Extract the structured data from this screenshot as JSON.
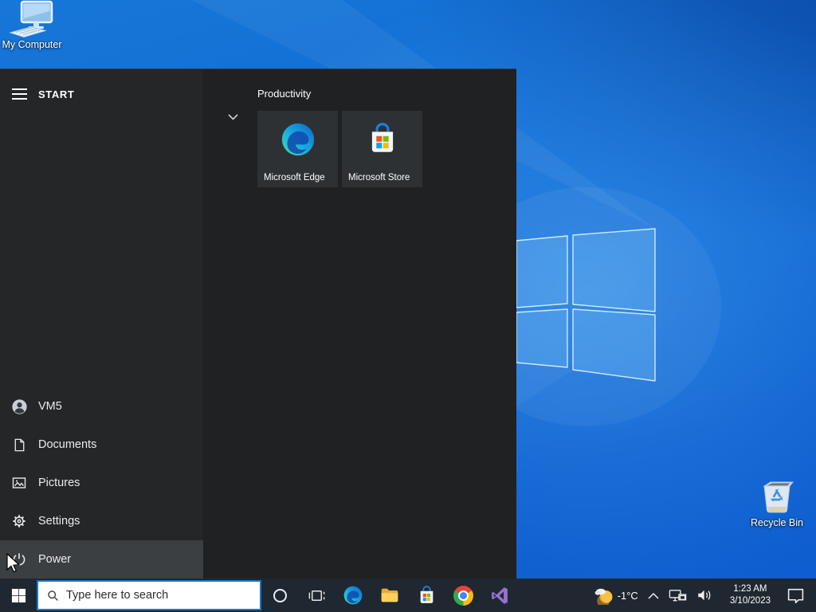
{
  "desktop": {
    "my_computer_label": "My Computer",
    "recycle_bin_label": "Recycle Bin"
  },
  "start_menu": {
    "header_label": "START",
    "group": {
      "title": "Productivity"
    },
    "tiles": [
      {
        "label": "Microsoft Edge"
      },
      {
        "label": "Microsoft Store"
      }
    ],
    "nav": [
      {
        "label": "VM5"
      },
      {
        "label": "Documents"
      },
      {
        "label": "Pictures"
      },
      {
        "label": "Settings"
      },
      {
        "label": "Power"
      }
    ]
  },
  "taskbar": {
    "search": {
      "placeholder": "Type here to search"
    },
    "tray": {
      "temperature": "-1°C",
      "time": "1:23 AM",
      "date": "3/10/2023"
    }
  },
  "colors": {
    "accent": "#0078d7",
    "taskbar_bg": "#1f2730",
    "start_menu_bg": "#202224",
    "tile_bg": "#2e3134",
    "wallpaper_blue": "#0d5fd0"
  }
}
